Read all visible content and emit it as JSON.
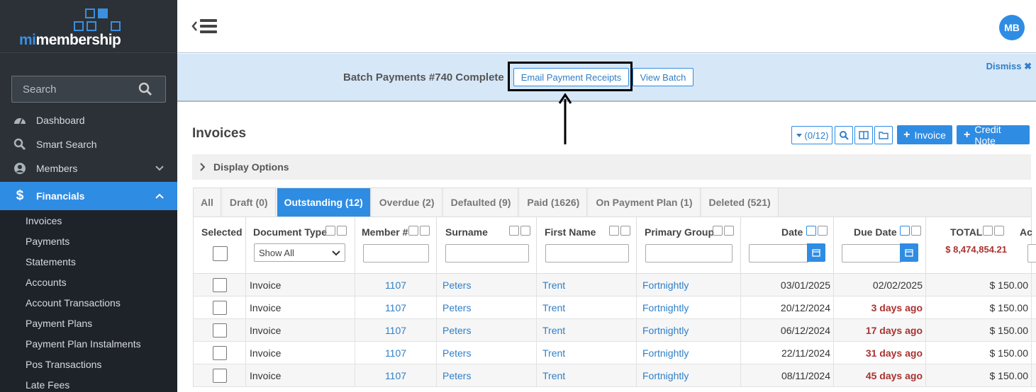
{
  "app": {
    "logo_prefix": "mi",
    "logo_suffix": "membership"
  },
  "sidebar": {
    "search_placeholder": "Search",
    "items": [
      {
        "label": "Dashboard",
        "icon": "dashboard-icon"
      },
      {
        "label": "Smart Search",
        "icon": "search-icon"
      },
      {
        "label": "Members",
        "icon": "user-icon"
      },
      {
        "label": "Financials",
        "icon": "dollar-icon"
      }
    ],
    "sub_items": [
      "Invoices",
      "Payments",
      "Statements",
      "Accounts",
      "Account Transactions",
      "Payment Plans",
      "Payment Plan Instalments",
      "Pos Transactions",
      "Late Fees"
    ]
  },
  "header": {
    "avatar_initials": "MB"
  },
  "banner": {
    "message": "Batch Payments #740 Complete",
    "email_receipts_label": "Email Payment Receipts",
    "view_batch_label": "View Batch",
    "dismiss_label": "Dismiss"
  },
  "page": {
    "title": "Invoices",
    "selection_count": "(0/12)",
    "invoice_button": "Invoice",
    "credit_note_button": "Credit Note",
    "display_options": "Display Options"
  },
  "tabs": [
    "All",
    "Draft (0)",
    "Outstanding (12)",
    "Overdue (2)",
    "Defaulted (9)",
    "Paid (1626)",
    "On Payment Plan (1)",
    "Deleted (521)"
  ],
  "columns": {
    "selected": "Selected",
    "document_type": "Document Type",
    "document_type_filter": "Show All",
    "member_no": "Member #",
    "surname": "Surname",
    "first_name": "First Name",
    "primary_group": "Primary Group",
    "date": "Date",
    "due_date": "Due Date",
    "total": "TOTAL",
    "total_sum": "$ 8,474,854.21",
    "actions": "Ac"
  },
  "rows": [
    {
      "type": "Invoice",
      "member": "1107",
      "surname": "Peters",
      "first": "Trent",
      "group": "Fortnightly",
      "date": "03/01/2025",
      "due": "02/02/2025",
      "due_overdue": false,
      "total": "$ 150.00"
    },
    {
      "type": "Invoice",
      "member": "1107",
      "surname": "Peters",
      "first": "Trent",
      "group": "Fortnightly",
      "date": "20/12/2024",
      "due": "3 days ago",
      "due_overdue": true,
      "total": "$ 150.00"
    },
    {
      "type": "Invoice",
      "member": "1107",
      "surname": "Peters",
      "first": "Trent",
      "group": "Fortnightly",
      "date": "06/12/2024",
      "due": "17 days ago",
      "due_overdue": true,
      "total": "$ 150.00"
    },
    {
      "type": "Invoice",
      "member": "1107",
      "surname": "Peters",
      "first": "Trent",
      "group": "Fortnightly",
      "date": "22/11/2024",
      "due": "31 days ago",
      "due_overdue": true,
      "total": "$ 150.00"
    },
    {
      "type": "Invoice",
      "member": "1107",
      "surname": "Peters",
      "first": "Trent",
      "group": "Fortnightly",
      "date": "08/11/2024",
      "due": "45 days ago",
      "due_overdue": true,
      "total": "$ 150.00"
    }
  ]
}
